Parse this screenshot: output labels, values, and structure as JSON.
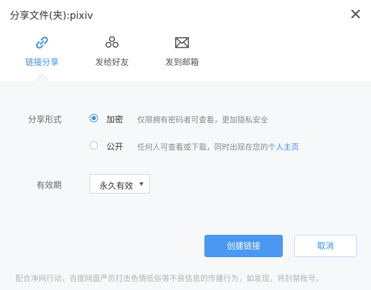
{
  "title": "分享文件(夹):pixiv",
  "tabs": [
    {
      "label": "链接分享",
      "icon": "link-icon",
      "active": true
    },
    {
      "label": "发给好友",
      "icon": "friends-icon",
      "active": false
    },
    {
      "label": "发到邮箱",
      "icon": "mail-icon",
      "active": false
    }
  ],
  "share_form": {
    "label": "分享形式",
    "options": [
      {
        "name": "加密",
        "desc": "仅限拥有密码者可查看，更加隐私安全",
        "selected": true
      },
      {
        "name": "公开",
        "desc": "任何人可查看或下载，同时出现在您的",
        "link": "个人主页",
        "selected": false
      }
    ]
  },
  "validity": {
    "label": "有效期",
    "value": "永久有效"
  },
  "buttons": {
    "create": "创建链接",
    "cancel": "取消"
  },
  "footer": "配合净网行动，百度网盘严厉打击色情低俗等不良信息的传播行为，如发现，将封禁账号。",
  "colors": {
    "accent": "#3a8ee6",
    "primary_button": "#4a98f2",
    "content_bg": "#f7f8fa"
  }
}
